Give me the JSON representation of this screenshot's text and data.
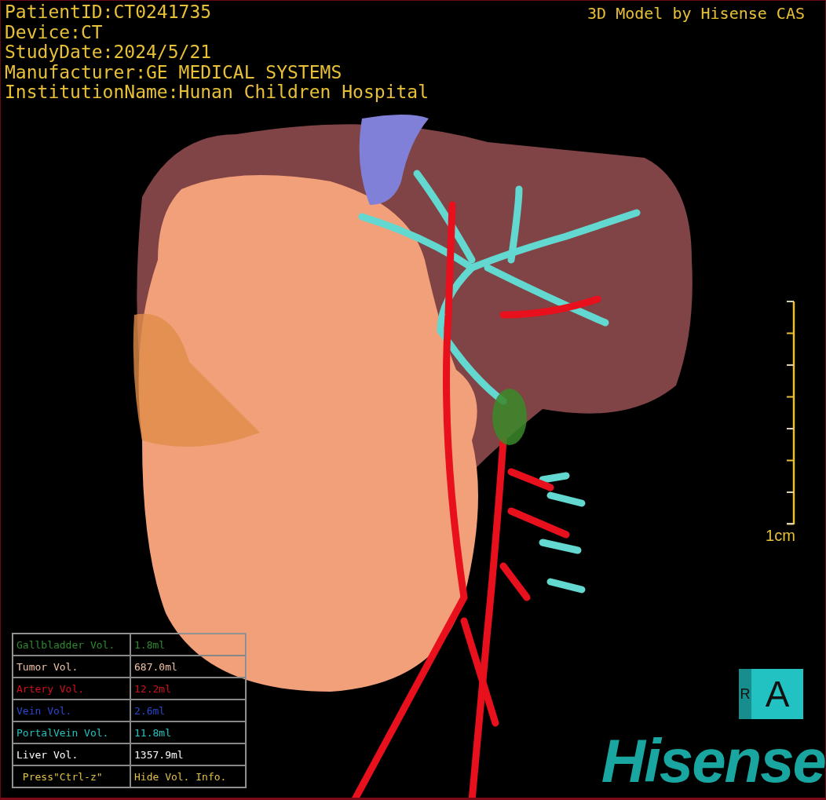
{
  "info_lines": [
    "PatientID:CT0241735",
    "Device:CT",
    "StudyDate:2024/5/21",
    "Manufacturer:GE MEDICAL SYSTEMS",
    "InstitutionName:Hunan Children Hospital"
  ],
  "credit": "3D Model by Hisense CAS",
  "scale_bar": {
    "label": "1cm"
  },
  "volume_table": {
    "rows": [
      {
        "label": "Gallbladder Vol.",
        "value": "1.8ml",
        "color": "#2e8a2e"
      },
      {
        "label": "Tumor Vol.",
        "value": "687.0ml",
        "color": "#f2c4a8"
      },
      {
        "label": "Artery Vol.",
        "value": "12.2ml",
        "color": "#d0101c"
      },
      {
        "label": "Vein Vol.",
        "value": "2.6ml",
        "color": "#2a48d0"
      },
      {
        "label": "PortalVein Vol.",
        "value": "11.8ml",
        "color": "#20c4c0"
      },
      {
        "label": "Liver Vol.",
        "value": "1357.9ml",
        "color": "#ffffff"
      }
    ],
    "hint": {
      "key": "Press\"Ctrl-z\"",
      "action": "Hide Vol. Info."
    }
  },
  "orientation_cube": {
    "side": "R",
    "front": "A"
  },
  "logo": "Hisense"
}
